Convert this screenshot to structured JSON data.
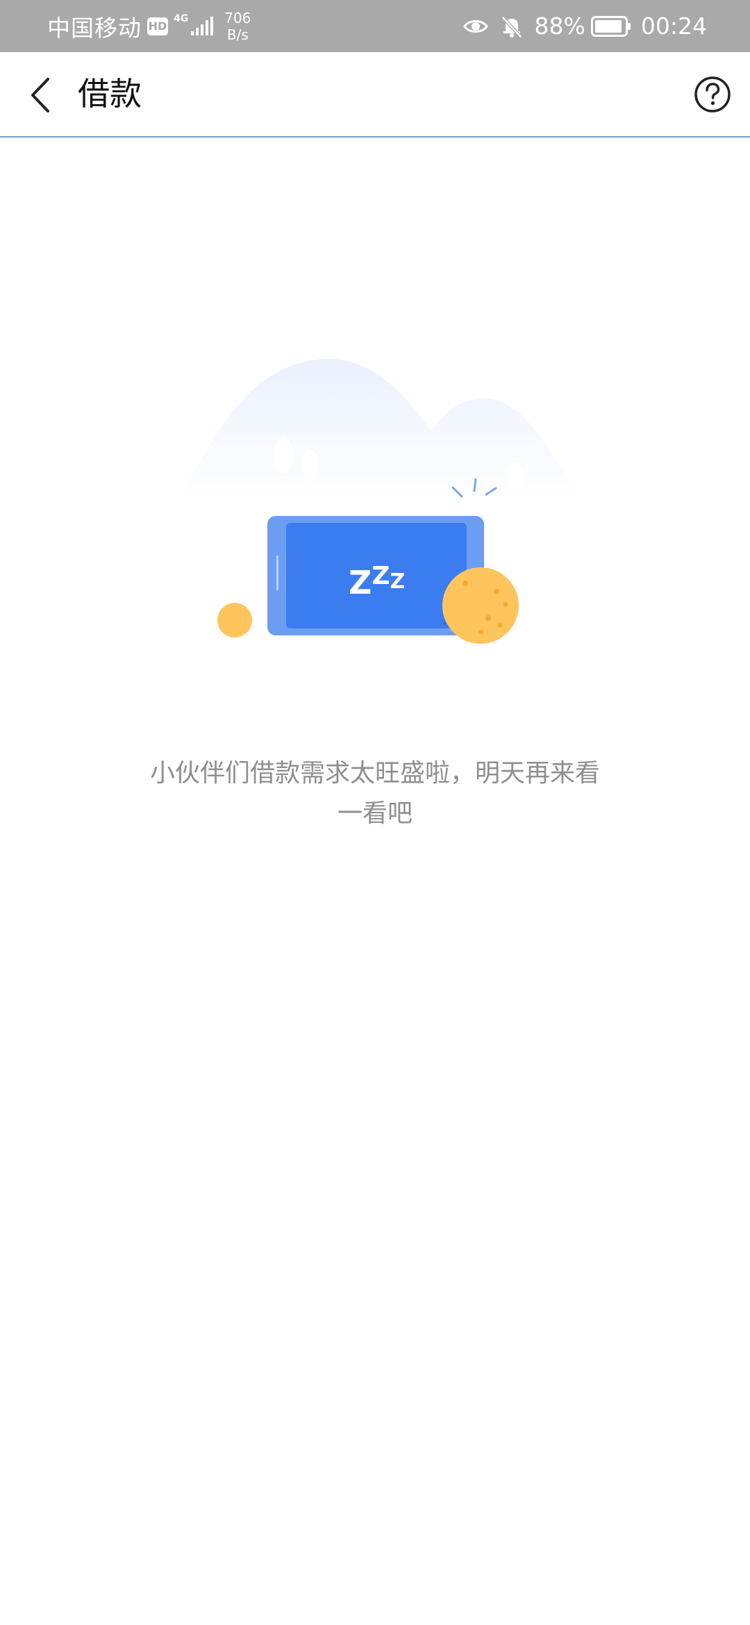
{
  "status_bar": {
    "carrier": "中国移动",
    "hd_badge": "HD",
    "network_type": "4G",
    "speed_value": "706",
    "speed_unit": "B/s",
    "battery_percent": "88%",
    "time": "00:24",
    "icons": [
      "eye-icon",
      "bell-off-icon",
      "battery-icon",
      "signal-icon"
    ]
  },
  "header": {
    "title": "借款",
    "back_icon": "chevron-left-icon",
    "help_icon": "question-circle-icon"
  },
  "empty_state": {
    "illustration_text": "ZZZ",
    "message": "小伙伴们借款需求太旺盛啦，明天再来看一看吧"
  },
  "colors": {
    "status_bar_bg": "#a9a9a9",
    "accent_blue": "#3b7cf0",
    "phone_frame": "#6b9ef2",
    "coin_yellow": "#ffc55c",
    "header_divider": "#6aa3c8",
    "message_text": "#8f8f8f"
  }
}
